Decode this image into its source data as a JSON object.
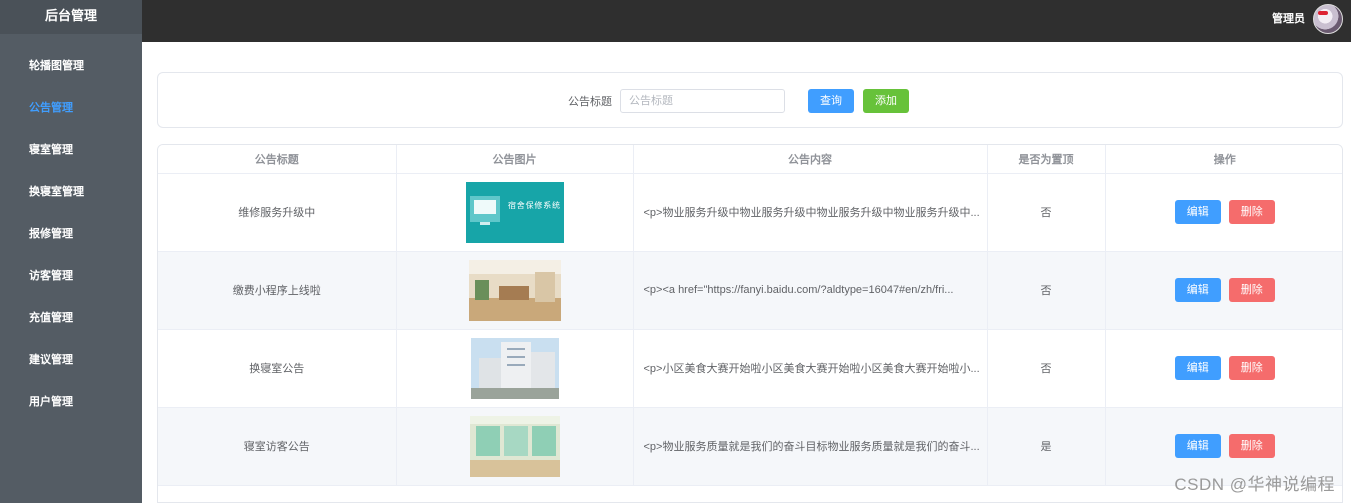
{
  "sidebar": {
    "title": "后台管理",
    "items": [
      {
        "label": "轮播图管理"
      },
      {
        "label": "公告管理"
      },
      {
        "label": "寝室管理"
      },
      {
        "label": "换寝室管理"
      },
      {
        "label": "报修管理"
      },
      {
        "label": "访客管理"
      },
      {
        "label": "充值管理"
      },
      {
        "label": "建议管理"
      },
      {
        "label": "用户管理"
      }
    ],
    "active_index": 1,
    "active_color": "#409eff"
  },
  "header": {
    "user_label": "管理员"
  },
  "search": {
    "label": "公告标题",
    "placeholder": "公告标题",
    "value": "",
    "query_label": "查询",
    "add_label": "添加"
  },
  "table": {
    "columns": [
      "公告标题",
      "公告图片",
      "公告内容",
      "是否为置顶",
      "操作"
    ],
    "rows": [
      {
        "title": "维修服务升级中",
        "image_text": "宿舍保修系统",
        "content": "<p>物业服务升级中物业服务升级中物业服务升级中物业服务升级中...",
        "pinned": "否",
        "edit": "编辑",
        "delete": "删除"
      },
      {
        "title": "缴费小程序上线啦",
        "content": "<p><a href=\"https://fanyi.baidu.com/?aldtype=16047#en/zh/fri...",
        "pinned": "否",
        "edit": "编辑",
        "delete": "删除"
      },
      {
        "title": "换寝室公告",
        "content": "<p>小区美食大赛开始啦小区美食大赛开始啦小区美食大赛开始啦小...",
        "pinned": "否",
        "edit": "编辑",
        "delete": "删除"
      },
      {
        "title": "寝室访客公告",
        "content": "<p>物业服务质量就是我们的奋斗目标物业服务质量就是我们的奋斗...",
        "pinned": "是",
        "edit": "编辑",
        "delete": "删除"
      }
    ]
  },
  "colors": {
    "primary": "#409eff",
    "success": "#67c23a",
    "danger": "#f56c6c",
    "sidebar": "#545c64",
    "header": "#2f2f2f"
  },
  "watermark": "CSDN @华神说编程"
}
